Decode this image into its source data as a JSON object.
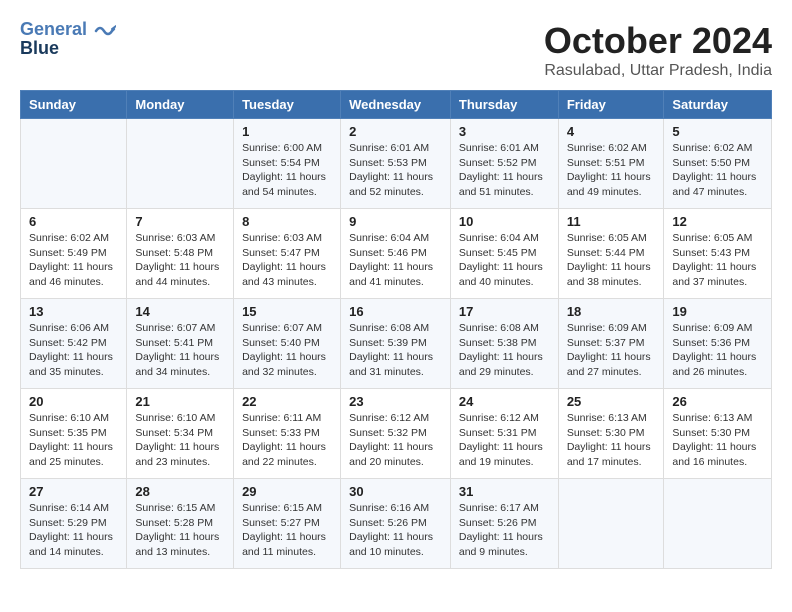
{
  "logo": {
    "line1": "General",
    "line2": "Blue"
  },
  "title": "October 2024",
  "location": "Rasulabad, Uttar Pradesh, India",
  "days_header": [
    "Sunday",
    "Monday",
    "Tuesday",
    "Wednesday",
    "Thursday",
    "Friday",
    "Saturday"
  ],
  "weeks": [
    [
      {
        "day": "",
        "info": ""
      },
      {
        "day": "",
        "info": ""
      },
      {
        "day": "1",
        "info": "Sunrise: 6:00 AM\nSunset: 5:54 PM\nDaylight: 11 hours and 54 minutes."
      },
      {
        "day": "2",
        "info": "Sunrise: 6:01 AM\nSunset: 5:53 PM\nDaylight: 11 hours and 52 minutes."
      },
      {
        "day": "3",
        "info": "Sunrise: 6:01 AM\nSunset: 5:52 PM\nDaylight: 11 hours and 51 minutes."
      },
      {
        "day": "4",
        "info": "Sunrise: 6:02 AM\nSunset: 5:51 PM\nDaylight: 11 hours and 49 minutes."
      },
      {
        "day": "5",
        "info": "Sunrise: 6:02 AM\nSunset: 5:50 PM\nDaylight: 11 hours and 47 minutes."
      }
    ],
    [
      {
        "day": "6",
        "info": "Sunrise: 6:02 AM\nSunset: 5:49 PM\nDaylight: 11 hours and 46 minutes."
      },
      {
        "day": "7",
        "info": "Sunrise: 6:03 AM\nSunset: 5:48 PM\nDaylight: 11 hours and 44 minutes."
      },
      {
        "day": "8",
        "info": "Sunrise: 6:03 AM\nSunset: 5:47 PM\nDaylight: 11 hours and 43 minutes."
      },
      {
        "day": "9",
        "info": "Sunrise: 6:04 AM\nSunset: 5:46 PM\nDaylight: 11 hours and 41 minutes."
      },
      {
        "day": "10",
        "info": "Sunrise: 6:04 AM\nSunset: 5:45 PM\nDaylight: 11 hours and 40 minutes."
      },
      {
        "day": "11",
        "info": "Sunrise: 6:05 AM\nSunset: 5:44 PM\nDaylight: 11 hours and 38 minutes."
      },
      {
        "day": "12",
        "info": "Sunrise: 6:05 AM\nSunset: 5:43 PM\nDaylight: 11 hours and 37 minutes."
      }
    ],
    [
      {
        "day": "13",
        "info": "Sunrise: 6:06 AM\nSunset: 5:42 PM\nDaylight: 11 hours and 35 minutes."
      },
      {
        "day": "14",
        "info": "Sunrise: 6:07 AM\nSunset: 5:41 PM\nDaylight: 11 hours and 34 minutes."
      },
      {
        "day": "15",
        "info": "Sunrise: 6:07 AM\nSunset: 5:40 PM\nDaylight: 11 hours and 32 minutes."
      },
      {
        "day": "16",
        "info": "Sunrise: 6:08 AM\nSunset: 5:39 PM\nDaylight: 11 hours and 31 minutes."
      },
      {
        "day": "17",
        "info": "Sunrise: 6:08 AM\nSunset: 5:38 PM\nDaylight: 11 hours and 29 minutes."
      },
      {
        "day": "18",
        "info": "Sunrise: 6:09 AM\nSunset: 5:37 PM\nDaylight: 11 hours and 27 minutes."
      },
      {
        "day": "19",
        "info": "Sunrise: 6:09 AM\nSunset: 5:36 PM\nDaylight: 11 hours and 26 minutes."
      }
    ],
    [
      {
        "day": "20",
        "info": "Sunrise: 6:10 AM\nSunset: 5:35 PM\nDaylight: 11 hours and 25 minutes."
      },
      {
        "day": "21",
        "info": "Sunrise: 6:10 AM\nSunset: 5:34 PM\nDaylight: 11 hours and 23 minutes."
      },
      {
        "day": "22",
        "info": "Sunrise: 6:11 AM\nSunset: 5:33 PM\nDaylight: 11 hours and 22 minutes."
      },
      {
        "day": "23",
        "info": "Sunrise: 6:12 AM\nSunset: 5:32 PM\nDaylight: 11 hours and 20 minutes."
      },
      {
        "day": "24",
        "info": "Sunrise: 6:12 AM\nSunset: 5:31 PM\nDaylight: 11 hours and 19 minutes."
      },
      {
        "day": "25",
        "info": "Sunrise: 6:13 AM\nSunset: 5:30 PM\nDaylight: 11 hours and 17 minutes."
      },
      {
        "day": "26",
        "info": "Sunrise: 6:13 AM\nSunset: 5:30 PM\nDaylight: 11 hours and 16 minutes."
      }
    ],
    [
      {
        "day": "27",
        "info": "Sunrise: 6:14 AM\nSunset: 5:29 PM\nDaylight: 11 hours and 14 minutes."
      },
      {
        "day": "28",
        "info": "Sunrise: 6:15 AM\nSunset: 5:28 PM\nDaylight: 11 hours and 13 minutes."
      },
      {
        "day": "29",
        "info": "Sunrise: 6:15 AM\nSunset: 5:27 PM\nDaylight: 11 hours and 11 minutes."
      },
      {
        "day": "30",
        "info": "Sunrise: 6:16 AM\nSunset: 5:26 PM\nDaylight: 11 hours and 10 minutes."
      },
      {
        "day": "31",
        "info": "Sunrise: 6:17 AM\nSunset: 5:26 PM\nDaylight: 11 hours and 9 minutes."
      },
      {
        "day": "",
        "info": ""
      },
      {
        "day": "",
        "info": ""
      }
    ]
  ]
}
